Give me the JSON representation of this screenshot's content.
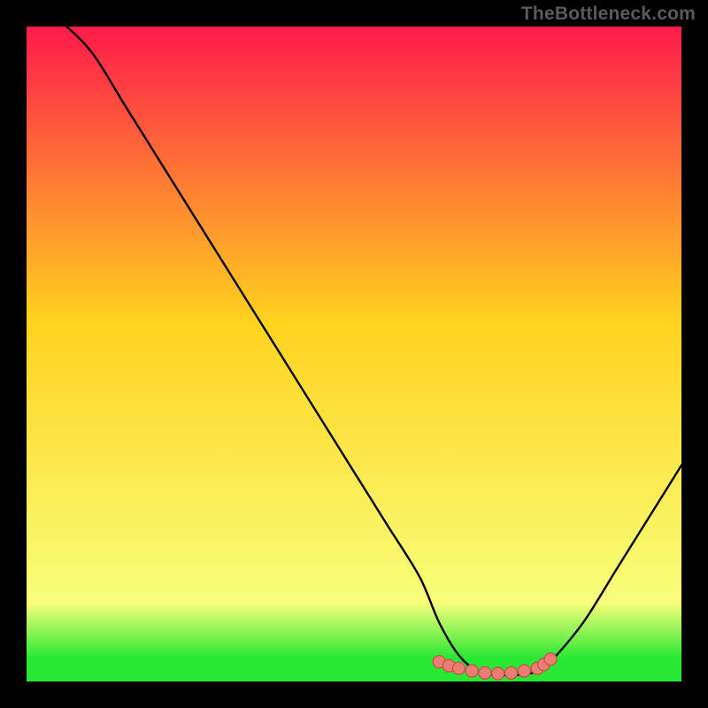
{
  "attribution": "TheBottleneck.com",
  "colors": {
    "frame": "#000000",
    "curve": "#000000",
    "green_band": "#27e833",
    "marker_fill": "#ed7c74",
    "marker_stroke": "#c94f46",
    "grad_top": "#ff1a4b",
    "grad_mid": "#ffd21e",
    "grad_low": "#f8ff7a",
    "grad_bottom": "#27e833"
  },
  "chart_data": {
    "type": "line",
    "title": "",
    "xlabel": "",
    "ylabel": "",
    "xlim": [
      0,
      100
    ],
    "ylim": [
      0,
      100
    ],
    "grid": false,
    "legend": false,
    "x": [
      0,
      5,
      10,
      15,
      20,
      25,
      30,
      35,
      40,
      45,
      50,
      55,
      60,
      63,
      66,
      69,
      72,
      75,
      78,
      80,
      85,
      90,
      95,
      100
    ],
    "values": [
      105,
      101,
      96,
      88,
      80,
      72,
      64,
      56,
      48,
      40,
      32,
      24,
      16,
      9,
      4,
      1.5,
      1,
      1,
      1.5,
      3,
      9,
      17,
      25,
      33
    ],
    "optimum_band": {
      "x_start": 63,
      "x_end": 80,
      "y": 1.2
    },
    "markers": {
      "x": [
        63,
        64.5,
        66,
        68,
        70,
        72,
        74,
        76,
        78,
        79,
        80
      ],
      "y": [
        3.0,
        2.4,
        2.0,
        1.6,
        1.3,
        1.2,
        1.3,
        1.6,
        2.0,
        2.6,
        3.4
      ]
    },
    "gradient_stops": [
      {
        "pos": 0.0,
        "color_key": "grad_top"
      },
      {
        "pos": 0.45,
        "color_key": "grad_mid"
      },
      {
        "pos": 0.88,
        "color_key": "grad_low"
      },
      {
        "pos": 0.965,
        "color_key": "grad_bottom"
      },
      {
        "pos": 1.0,
        "color_key": "grad_bottom"
      }
    ],
    "green_band_fraction": 0.035
  }
}
